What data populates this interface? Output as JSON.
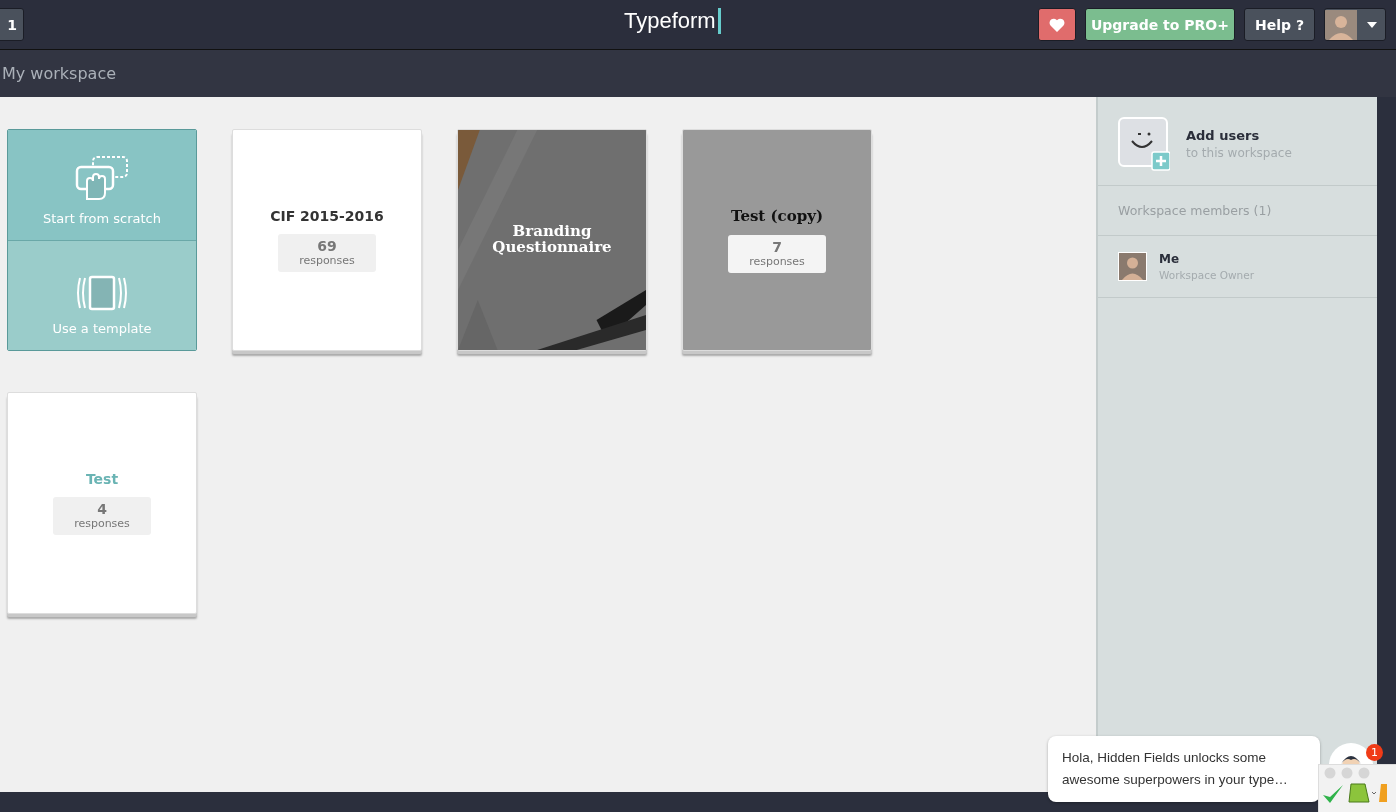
{
  "topbar": {
    "left_button": "1",
    "title": "Typeform",
    "heart_button": {
      "kind": "heart"
    },
    "upgrade_button": "Upgrade to PRO+",
    "help_button": "Help ?"
  },
  "workspace_title": "My workspace",
  "create_tiles": [
    {
      "kind": "scratch",
      "label": "Start from scratch"
    },
    {
      "kind": "template",
      "label": "Use a template"
    }
  ],
  "forms": [
    {
      "kind": "plain",
      "title": "CIF 2015-2016",
      "count": "69",
      "count_label": "responses"
    },
    {
      "title": "Branding Questionnaire"
    },
    {
      "kind": "muted",
      "title": "Test (copy)",
      "count": "7",
      "count_label": "responses"
    },
    {
      "kind": "accent",
      "title": "Test",
      "count": "4",
      "count_label": "responses"
    }
  ],
  "sidebar": {
    "add_users": {
      "title": "Add users",
      "subtitle": "to this workspace"
    },
    "members_heading": "Workspace members (1)",
    "members": [
      {
        "name": "Me",
        "role": "Workspace Owner"
      }
    ]
  },
  "chat": {
    "message": "Hola, Hidden Fields unlocks some awesome superpowers in your type…",
    "badge": "1"
  }
}
